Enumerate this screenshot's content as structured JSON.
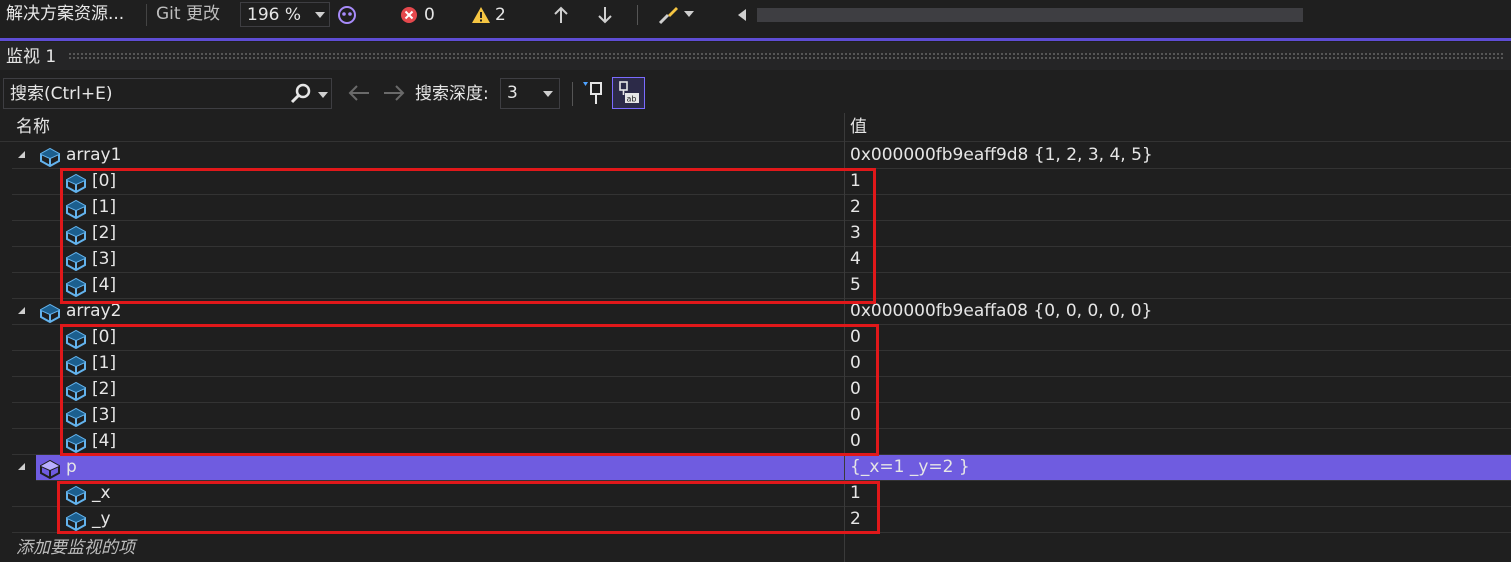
{
  "top_tabs": {
    "solution_explorer": "解决方案资源...",
    "git_changes": "Git 更改",
    "zoom": "196 %",
    "errors_count": "0",
    "warnings_count": "2"
  },
  "panel": {
    "title": "监视 1"
  },
  "toolbar": {
    "search_placeholder": "搜索(Ctrl+E)",
    "depth_label": "搜索深度:",
    "depth_value": "3"
  },
  "columns": {
    "name": "名称",
    "value": "值"
  },
  "rows": [
    {
      "name": "array1",
      "value": "0x000000fb9eaff9d8 {1, 2, 3, 4, 5}"
    },
    {
      "name": "[0]",
      "value": "1"
    },
    {
      "name": "[1]",
      "value": "2"
    },
    {
      "name": "[2]",
      "value": "3"
    },
    {
      "name": "[3]",
      "value": "4"
    },
    {
      "name": "[4]",
      "value": "5"
    },
    {
      "name": "array2",
      "value": "0x000000fb9eaffa08 {0, 0, 0, 0, 0}"
    },
    {
      "name": "[0]",
      "value": "0"
    },
    {
      "name": "[1]",
      "value": "0"
    },
    {
      "name": "[2]",
      "value": "0"
    },
    {
      "name": "[3]",
      "value": "0"
    },
    {
      "name": "[4]",
      "value": "0"
    },
    {
      "name": "p",
      "value": "{_x=1 _y=2 }"
    },
    {
      "name": "_x",
      "value": "1"
    },
    {
      "name": "_y",
      "value": "2"
    }
  ],
  "add_watch_placeholder": "添加要监视的项",
  "colors": {
    "selection": "#6f5ce0",
    "highlight_box": "#e0181a",
    "accent": "#5e4dd4"
  }
}
